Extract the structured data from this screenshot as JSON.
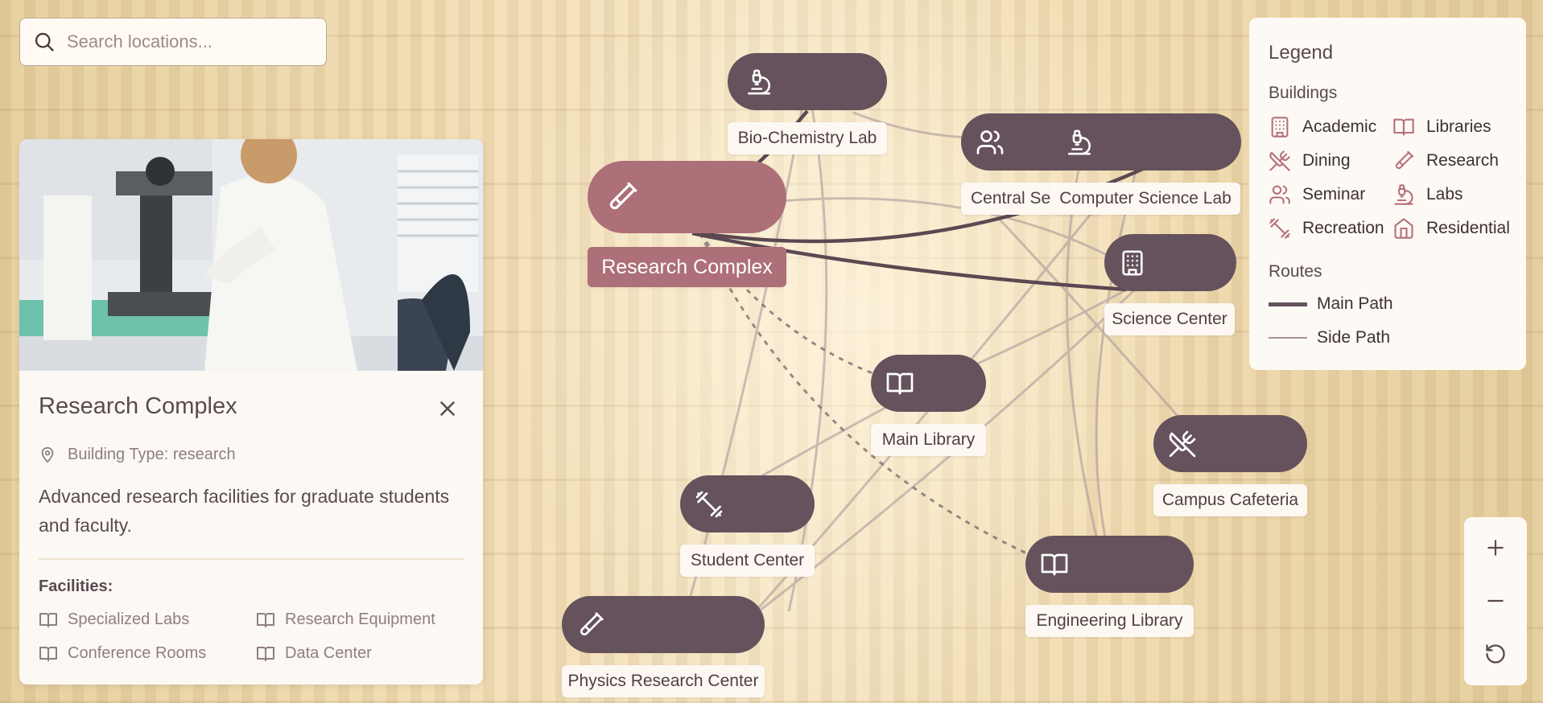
{
  "search": {
    "placeholder": "Search locations..."
  },
  "panel": {
    "title": "Research Complex",
    "building_type": "Building Type: research",
    "description": "Advanced research facilities for graduate students and faculty.",
    "facilities_heading": "Facilities:",
    "facilities": [
      "Specialized Labs",
      "Research Equipment",
      "Conference Rooms",
      "Data Center"
    ]
  },
  "nodes": [
    {
      "label": "Bio-Chemistry Lab",
      "icon": "microscope-icon"
    },
    {
      "label": "Research Complex",
      "icon": "test-tube-icon",
      "selected": true
    },
    {
      "label": "Central Seminar Hall",
      "icon": "users-icon"
    },
    {
      "label": "Computer Science Lab",
      "icon": "microscope-icon"
    },
    {
      "label": "Science Center",
      "icon": "building-icon"
    },
    {
      "label": "Main Library",
      "icon": "book-icon"
    },
    {
      "label": "Campus Cafeteria",
      "icon": "utensils-icon"
    },
    {
      "label": "Student Center",
      "icon": "dumbbell-icon"
    },
    {
      "label": "Engineering Library",
      "icon": "book-icon"
    },
    {
      "label": "Physics Research Center",
      "icon": "test-tube-icon"
    }
  ],
  "legend": {
    "title": "Legend",
    "buildings_heading": "Buildings",
    "buildings": [
      {
        "label": "Academic",
        "icon": "building-icon"
      },
      {
        "label": "Libraries",
        "icon": "book-icon"
      },
      {
        "label": "Dining",
        "icon": "utensils-icon"
      },
      {
        "label": "Research",
        "icon": "test-tube-icon"
      },
      {
        "label": "Seminar",
        "icon": "users-icon"
      },
      {
        "label": "Labs",
        "icon": "microscope-icon"
      },
      {
        "label": "Recreation",
        "icon": "dumbbell-icon"
      },
      {
        "label": "Residential",
        "icon": "home-icon"
      }
    ],
    "routes_heading": "Routes",
    "routes": [
      {
        "label": "Main Path",
        "color": "#65525c"
      },
      {
        "label": "Side Path",
        "color": "#a89298"
      }
    ]
  },
  "zoom": {
    "in": "+",
    "out": "−"
  },
  "colors": {
    "node": "#65525c",
    "selected": "#ad6f78",
    "panel": "#fcf8f4",
    "accent_icon": "#b5707a"
  }
}
